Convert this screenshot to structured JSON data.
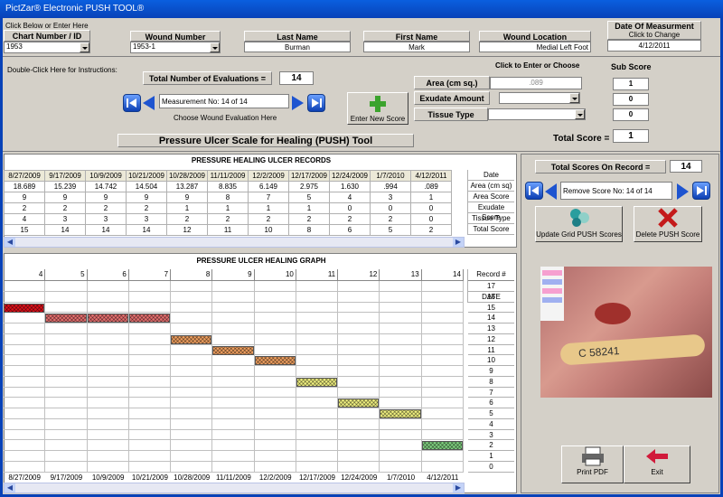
{
  "window": {
    "title": "PictZar® Electronic PUSH TOOL®"
  },
  "header": {
    "hint": "Click Below or Enter Here",
    "chart_label": "Chart Number / ID",
    "chart_value": "1953",
    "wound_label": "Wound Number",
    "wound_value": "1953-1",
    "last_label": "Last Name",
    "last_value": "Burman",
    "first_label": "First Name",
    "first_value": "Mark",
    "loc_label": "Wound Location",
    "loc_value": "Medial Left Foot",
    "date_label": "Date Of Measurment",
    "date_hint": "Click to Change",
    "date_value": "4/12/2011"
  },
  "controls": {
    "instructions": "Double-Click Here for Instructions:",
    "total_evals_label": "Total Number of Evaluations =",
    "total_evals_value": "14",
    "measurement_value": "Measurement No: 14 of 14",
    "choose_label": "Choose Wound Evaluation Here",
    "enter_new": "Enter New Score",
    "click_enter": "Click to Enter or Choose",
    "sub_score": "Sub Score",
    "area_label": "Area (cm sq.)",
    "area_value": ".089",
    "area_sub": "1",
    "exudate_label": "Exudate Amount",
    "exudate_sub": "0",
    "tissue_label": "Tissue Type",
    "tissue_sub": "0",
    "total_label": "Total Score =",
    "total_value": "1",
    "tool_title": "Pressure Ulcer Scale for Healing  (PUSH) Tool"
  },
  "records": {
    "title": "PRESSURE HEALING ULCER RECORDS",
    "dates": [
      "8/27/2009",
      "9/17/2009",
      "10/9/2009",
      "10/21/2009",
      "10/28/2009",
      "11/11/2009",
      "12/2/2009",
      "12/17/2009",
      "12/24/2009",
      "1/7/2010",
      "4/12/2011"
    ],
    "area": [
      "18.689",
      "15.239",
      "14.742",
      "14.504",
      "13.287",
      "8.835",
      "6.149",
      "2.975",
      "1.630",
      ".994",
      ".089"
    ],
    "area_score": [
      "9",
      "9",
      "9",
      "9",
      "9",
      "8",
      "7",
      "5",
      "4",
      "3",
      "1"
    ],
    "exudate_score": [
      "2",
      "2",
      "2",
      "2",
      "1",
      "1",
      "1",
      "1",
      "0",
      "0",
      "0"
    ],
    "tissue_type": [
      "4",
      "3",
      "3",
      "3",
      "2",
      "2",
      "2",
      "2",
      "2",
      "2",
      "0"
    ],
    "total_score": [
      "15",
      "14",
      "14",
      "14",
      "12",
      "11",
      "10",
      "8",
      "6",
      "5",
      "2"
    ],
    "row_labels": [
      "Date",
      "Area (cm sq)",
      "Area Score",
      "Exudate Score",
      "Tissue Type",
      "Total Score"
    ]
  },
  "graph": {
    "title": "PRESSURE ULCER HEALING GRAPH",
    "columns": [
      "4",
      "5",
      "6",
      "7",
      "8",
      "9",
      "10",
      "11",
      "12",
      "13",
      "14"
    ],
    "record_label": "Record #",
    "record_nums": [
      "17",
      "16",
      "15",
      "14",
      "13",
      "12",
      "11",
      "10",
      "9",
      "8",
      "7",
      "6",
      "5",
      "4",
      "3",
      "2",
      "1",
      "0"
    ],
    "date_label": "DATE",
    "bar_colors": [
      "#e0101a",
      "#e87070",
      "#e87070",
      "#e87070",
      "#f0a060",
      "#f0a060",
      "#f0a060",
      "#f0f080",
      "#f0f080",
      "#f0f080",
      "#80d080"
    ]
  },
  "right": {
    "total_scores_label": "Total Scores On Record =",
    "total_scores_value": "14",
    "remove_value": "Remove Score No: 14 of 14",
    "update_label": "Update Grid PUSH Scores",
    "delete_label": "Delete PUSH Score",
    "print_label": "Print PDF",
    "exit_label": "Exit",
    "photo_label": "C 58241"
  }
}
